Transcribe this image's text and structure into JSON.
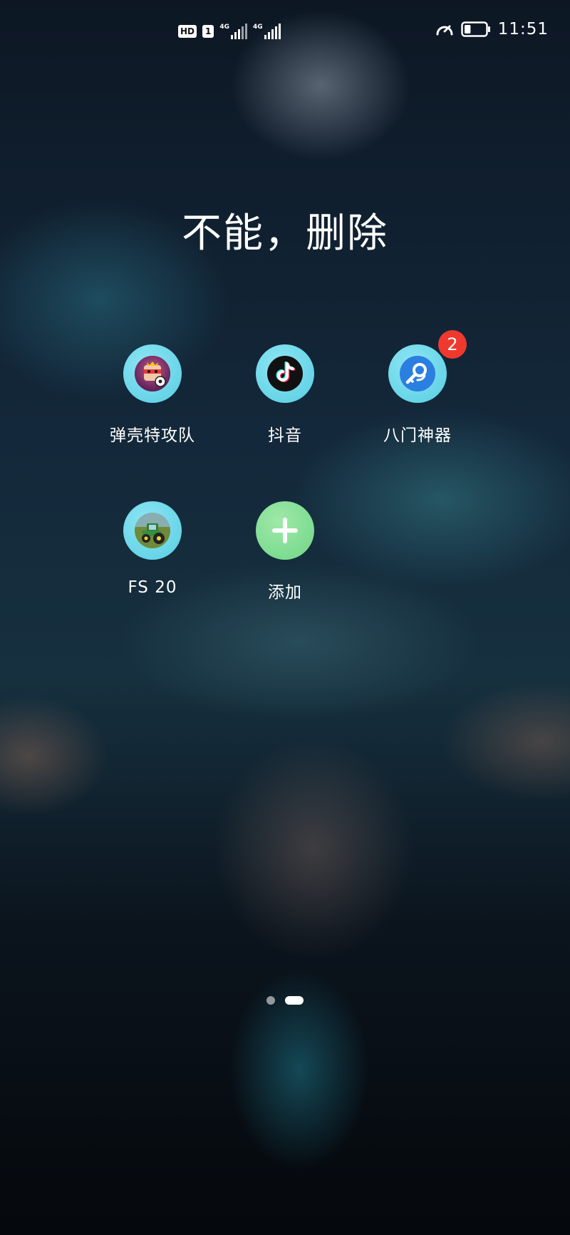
{
  "status_bar": {
    "hd_label": "HD",
    "sim_label": "1",
    "network1_label": "4G",
    "network2_label": "4G",
    "time": "11:51",
    "battery_level": 0.3
  },
  "folder": {
    "title": "不能，删除"
  },
  "apps": [
    {
      "label": "弹壳特攻队",
      "icon": "game-character-icon"
    },
    {
      "label": "抖音",
      "icon": "tiktok-icon"
    },
    {
      "label": "八门神器",
      "icon": "key-search-icon",
      "badge": "2"
    },
    {
      "label": "FS 20",
      "icon": "tractor-icon"
    },
    {
      "label": "添加",
      "icon": "plus-icon"
    }
  ],
  "page_indicator": {
    "total": 2,
    "current": 2
  }
}
